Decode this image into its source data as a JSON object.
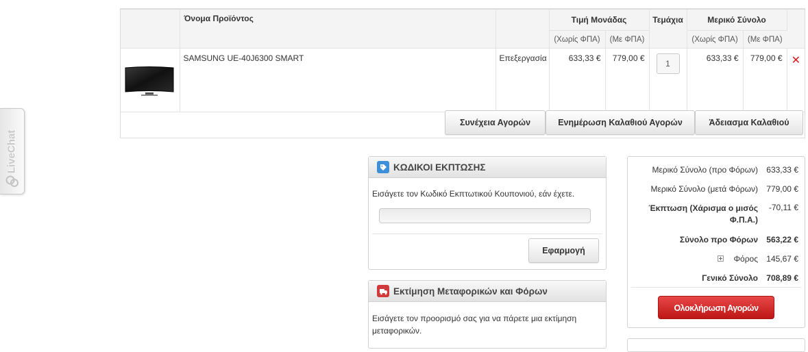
{
  "livechat": {
    "label": "LiveChat"
  },
  "cart": {
    "headers": {
      "product_name": "Όνομα Προϊόντος",
      "unit_price": "Τιμή Μονάδας",
      "quantity": "Τεμάχια",
      "subtotal": "Μερικό Σύνολο",
      "excl_vat": "(Χωρίς ΦΠΑ)",
      "incl_vat": "(Με ΦΠΑ)"
    },
    "items": [
      {
        "name": "SAMSUNG UE-40J6300 SMART",
        "status": "Επεξεργασία",
        "unit_excl": "633,33 €",
        "unit_incl": "779,00 €",
        "qty": "1",
        "sub_excl": "633,33 €",
        "sub_incl": "779,00 €",
        "remove_icon": "close-icon"
      }
    ],
    "buttons": {
      "continue": "Συνέχεια Αγορών",
      "update": "Ενημέρωση Καλαθιού Αγορών",
      "empty": "Άδειασμα Καλαθιού"
    }
  },
  "coupon": {
    "title": "ΚΩΔΙΚΟΙ ΕΚΠΤΩΣΗΣ",
    "icon": "discount-tag-icon",
    "text": "Εισάγετε τον Κωδικό Εκπτωτικού Κουπονιού, εάν έχετε.",
    "input_value": "",
    "apply": "Εφαρμογή"
  },
  "shipping": {
    "title": "Εκτίμηση Μεταφορικών και Φόρων",
    "icon": "truck-icon",
    "text": "Εισάγετε τον προορισμό σας για να πάρετε μια εκτίμηση μεταφορικών."
  },
  "totals": {
    "rows": [
      {
        "label": "Μερικό Σύνολο (προ Φόρων)",
        "value": "633,33 €"
      },
      {
        "label": "Μερικό Σύνολο (μετά Φόρων)",
        "value": "779,00 €"
      },
      {
        "label_line1": "Έκπτωση (Χάρισμα ο μισός",
        "label_line2": "Φ.Π.Α.)",
        "value": "-70,11 €"
      },
      {
        "label": "Σύνολο προ Φόρων",
        "value": "563,22 €"
      },
      {
        "label": "Φόρος",
        "value": "145,67 €"
      },
      {
        "label": "Γενικό Σύνολο",
        "value": "708,89 €"
      }
    ],
    "checkout": "Ολοκλήρωση Αγορών"
  },
  "colors": {
    "accent_red": "#d41c1c",
    "checkout_red": "#d42a2a",
    "coupon_icon": "#3d8fd9",
    "shipping_icon": "#d03a3a"
  }
}
